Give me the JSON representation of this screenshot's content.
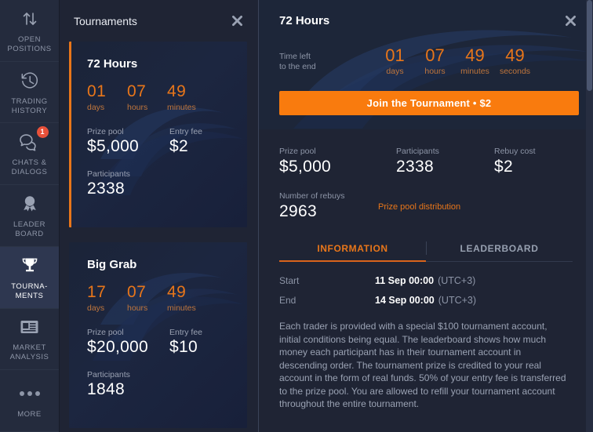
{
  "sidebar": {
    "items": [
      {
        "label": "Open\nPositions",
        "line1": "OPEN",
        "line2": "POSITIONS",
        "icon": "arrows-up-down-icon",
        "active": false,
        "badge": null
      },
      {
        "label": "Trading History",
        "line1": "TRADING",
        "line2": "HISTORY",
        "icon": "clock-history-icon",
        "active": false,
        "badge": null
      },
      {
        "label": "Chats & Dialogs",
        "line1": "CHATS &",
        "line2": "DIALOGS",
        "icon": "chat-bubbles-icon",
        "active": false,
        "badge": "1"
      },
      {
        "label": "Leader Board",
        "line1": "LEADER",
        "line2": "BOARD",
        "icon": "medal-icon",
        "active": false,
        "badge": null
      },
      {
        "label": "Tournaments",
        "line1": "TOURNA-",
        "line2": "MENTS",
        "icon": "trophy-icon",
        "active": true,
        "badge": null
      },
      {
        "label": "Market Analysis",
        "line1": "MARKET",
        "line2": "ANALYSIS",
        "icon": "news-card-icon",
        "active": false,
        "badge": null
      },
      {
        "label": "More",
        "line1": "MORE",
        "line2": "",
        "icon": "ellipsis-icon",
        "active": false,
        "badge": null
      }
    ]
  },
  "list_panel": {
    "title": "Tournaments",
    "close_icon": "close-icon",
    "cards": [
      {
        "name": "72 Hours",
        "selected": true,
        "countdown": [
          {
            "value": "01",
            "unit": "days"
          },
          {
            "value": "07",
            "unit": "hours"
          },
          {
            "value": "49",
            "unit": "minutes"
          }
        ],
        "prize_pool_label": "Prize pool",
        "prize_pool_value": "$5,000",
        "entry_fee_label": "Entry fee",
        "entry_fee_value": "$2",
        "participants_label": "Participants",
        "participants_value": "2338"
      },
      {
        "name": "Big Grab",
        "selected": false,
        "countdown": [
          {
            "value": "17",
            "unit": "days"
          },
          {
            "value": "07",
            "unit": "hours"
          },
          {
            "value": "49",
            "unit": "minutes"
          }
        ],
        "prize_pool_label": "Prize pool",
        "prize_pool_value": "$20,000",
        "entry_fee_label": "Entry fee",
        "entry_fee_value": "$10",
        "participants_label": "Participants",
        "participants_value": "1848"
      }
    ]
  },
  "detail": {
    "title": "72 Hours",
    "close_icon": "close-icon",
    "timer_lead_line1": "Time left",
    "timer_lead_line2": "to the end",
    "countdown": [
      {
        "value": "01",
        "unit": "days"
      },
      {
        "value": "07",
        "unit": "hours"
      },
      {
        "value": "49",
        "unit": "minutes"
      },
      {
        "value": "49",
        "unit": "seconds"
      }
    ],
    "join_button": "Join the Tournament • $2",
    "stats": [
      {
        "label": "Prize pool",
        "value": "$5,000"
      },
      {
        "label": "Participants",
        "value": "2338"
      },
      {
        "label": "Rebuy cost",
        "value": "$2"
      }
    ],
    "rebuys_label": "Number of rebuys",
    "rebuys_value": "2963",
    "prize_distribution_link": "Prize pool distribution",
    "tabs": [
      {
        "label": "INFORMATION",
        "active": true
      },
      {
        "label": "LEADERBOARD",
        "active": false
      }
    ],
    "schedule": [
      {
        "key": "Start",
        "value": "11 Sep 00:00",
        "tz": "(UTC+3)"
      },
      {
        "key": "End",
        "value": "14 Sep 00:00",
        "tz": "(UTC+3)"
      }
    ],
    "description": "Each trader is provided with a special $100 tournament account, initial conditions being equal. The leaderboard shows how much money each participant has in their tournament account in descending order. The tournament prize is credited to your real account in the form of real funds. 50% of your entry fee is transferred to the prize pool. You are allowed to refill your tournament account throughout the entire tournament."
  },
  "colors": {
    "accent_orange": "#e8761a",
    "button_orange": "#f97b0e",
    "badge_red": "#e8513a",
    "panel_bg": "#1f2434",
    "sidebar_bg": "#242b3d",
    "card_bg": "#1c2640"
  }
}
